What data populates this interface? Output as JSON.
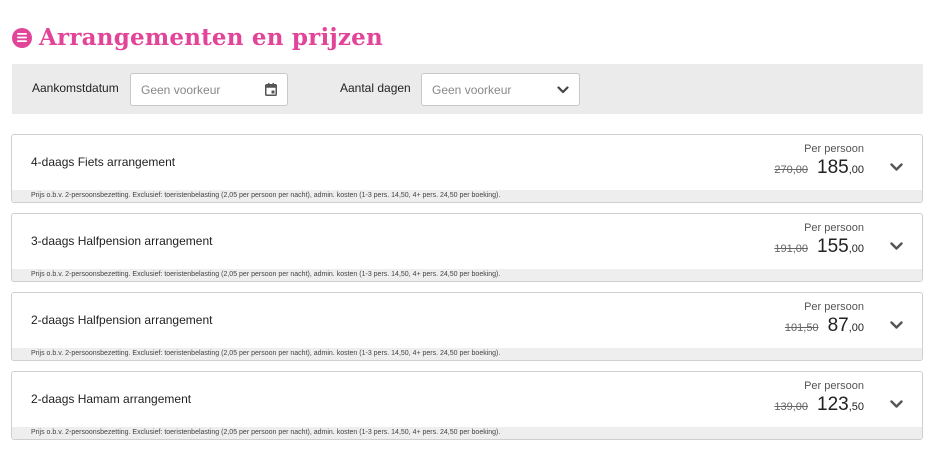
{
  "header": {
    "title": "Arrangementen en prijzen",
    "icon": "menu-list-icon",
    "accent_color": "#e2449a"
  },
  "filters": {
    "arrival": {
      "label": "Aankomstdatum",
      "placeholder": "Geen voorkeur",
      "icon": "calendar-icon"
    },
    "days": {
      "label": "Aantal dagen",
      "placeholder": "Geen voorkeur",
      "icon": "chevron-down-icon"
    }
  },
  "arrangements": [
    {
      "title": "4-daags Fiets arrangement",
      "per_person": "Per persoon",
      "old_price": "270,00",
      "price_main": "185",
      "price_cents": ",00",
      "note": "Prijs o.b.v. 2-persoonsbezetting. Exclusief: toeristenbelasting (2,05 per persoon per nacht), admin. kosten (1-3 pers. 14,50, 4+ pers. 24,50 per boeking)."
    },
    {
      "title": "3-daags Halfpension arrangement",
      "per_person": "Per persoon",
      "old_price": "191,00",
      "price_main": "155",
      "price_cents": ",00",
      "note": "Prijs o.b.v. 2-persoonsbezetting. Exclusief: toeristenbelasting (2,05 per persoon per nacht), admin. kosten (1-3 pers. 14,50, 4+ pers. 24,50 per boeking)."
    },
    {
      "title": "2-daags Halfpension arrangement",
      "per_person": "Per persoon",
      "old_price": "101,50",
      "price_main": "87",
      "price_cents": ",00",
      "note": "Prijs o.b.v. 2-persoonsbezetting. Exclusief: toeristenbelasting (2,05 per persoon per nacht), admin. kosten (1-3 pers. 14,50, 4+ pers. 24,50 per boeking)."
    },
    {
      "title": "2-daags Hamam arrangement",
      "per_person": "Per persoon",
      "old_price": "139,00",
      "price_main": "123",
      "price_cents": ",50",
      "note": "Prijs o.b.v. 2-persoonsbezetting. Exclusief: toeristenbelasting (2,05 per persoon per nacht), admin. kosten (1-3 pers. 14,50, 4+ pers. 24,50 per boeking)."
    }
  ]
}
